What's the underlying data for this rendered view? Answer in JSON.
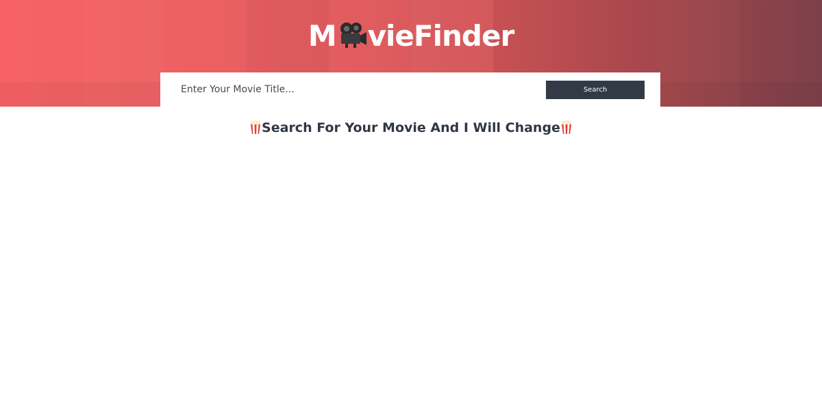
{
  "header": {
    "logo": {
      "prefix": "M",
      "suffix": "vieFinder",
      "icon": "movie-camera-icon"
    },
    "colors": {
      "gradient_start": "#f76266",
      "gradient_end": "#874550"
    }
  },
  "search": {
    "placeholder": "Enter Your Movie Title...",
    "value": "",
    "button_label": "Search",
    "button_color": "#323a45"
  },
  "main": {
    "tagline": "Search For Your Movie And I Will Change",
    "tagline_icon": "popcorn-icon",
    "tagline_color": "#2f3744"
  }
}
